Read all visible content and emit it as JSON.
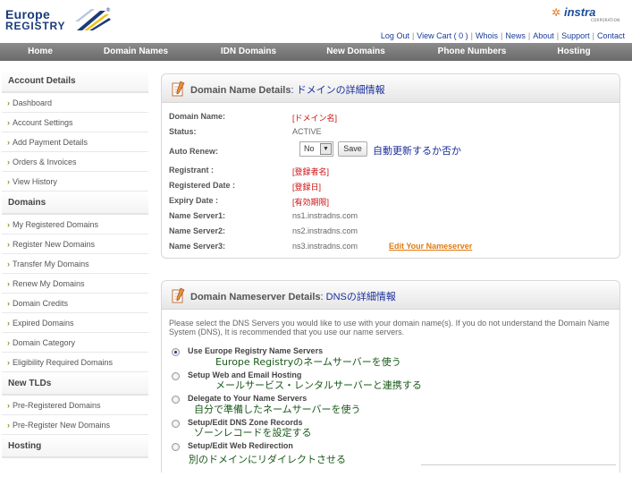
{
  "header": {
    "logo_line1": "Europe",
    "logo_line2": "REGISTRY",
    "logo_reg": "®",
    "partner_logo": "instra",
    "partner_sub": "CORPORATION",
    "links": [
      "Log Out",
      "View Cart ( 0 )",
      "Whois",
      "News",
      "About",
      "Support",
      "Contact"
    ]
  },
  "nav": {
    "items": [
      "Home",
      "Domain Names",
      "IDN Domains",
      "New Domains",
      "Phone Numbers",
      "Hosting"
    ]
  },
  "sidebar": {
    "sections": [
      {
        "title": "Account Details",
        "items": [
          "Dashboard",
          "Account Settings",
          "Add Payment Details",
          "Orders & Invoices",
          "View History"
        ]
      },
      {
        "title": "Domains",
        "items": [
          "My Registered Domains",
          "Register New Domains",
          "Transfer My Domains",
          "Renew My Domains",
          "Domain Credits",
          "Expired Domains",
          "Domain Category",
          "Eligibility Required Domains"
        ]
      },
      {
        "title": "New TLDs",
        "items": [
          "Pre-Registered Domains",
          "Pre-Register New Domains"
        ]
      },
      {
        "title": "Hosting",
        "items": []
      }
    ]
  },
  "details": {
    "title": "Domain Name Details",
    "title_jp": ": ドメインの詳細情報",
    "rows": {
      "domain_name": {
        "label": "Domain Name:",
        "value": "[ドメイン名]"
      },
      "status": {
        "label": "Status:",
        "value": "ACTIVE"
      },
      "auto_renew": {
        "label": "Auto Renew:",
        "value": "No",
        "save": "Save",
        "note": "自動更新するか否か"
      },
      "registrant": {
        "label": "Registrant :",
        "value": "[登録者名]"
      },
      "registered_date": {
        "label": "Registered Date :",
        "value": "[登録日]"
      },
      "expiry_date": {
        "label": "Expiry Date :",
        "value": "[有効期限]"
      },
      "ns1": {
        "label": "Name Server1:",
        "value": "ns1.instradns.com"
      },
      "ns2": {
        "label": "Name Server2:",
        "value": "ns2.instradns.com"
      },
      "ns3": {
        "label": "Name Server3:",
        "value": "ns3.instradns.com",
        "edit": "Edit Your Nameserver"
      }
    }
  },
  "dns": {
    "title": "Domain Nameserver Details",
    "title_jp": ": DNSの詳細情報",
    "description": "Please select the DNS Servers you would like to use with your domain name(s). If you do not understand the Domain Name System (DNS), It is recommended that you use our name servers.",
    "options": [
      {
        "label": "Use Europe Registry Name Servers",
        "note": "Europe Registryのネームサーバーを使う",
        "checked": true
      },
      {
        "label": "Setup Web and Email Hosting",
        "note": "メールサービス・レンタルサーバーと連携する",
        "checked": false
      },
      {
        "label": "Delegate to Your Name Servers",
        "note": "自分で準備したネームサーバーを使う",
        "checked": false
      },
      {
        "label": "Setup/Edit DNS Zone Records",
        "note": "ゾーンレコードを設定する",
        "checked": false
      },
      {
        "label": "Setup/Edit Web Redirection",
        "note": "別のドメインにリダイレクトさせる",
        "checked": false
      }
    ]
  },
  "colors": {
    "nav_bg": "#7a7a7a",
    "link": "#1a3b9a",
    "accent_orange": "#e07a10",
    "jp_note_blue": "#1a2f9a",
    "jp_note_green": "#1a5a1a",
    "value_red": "#cc1010"
  }
}
